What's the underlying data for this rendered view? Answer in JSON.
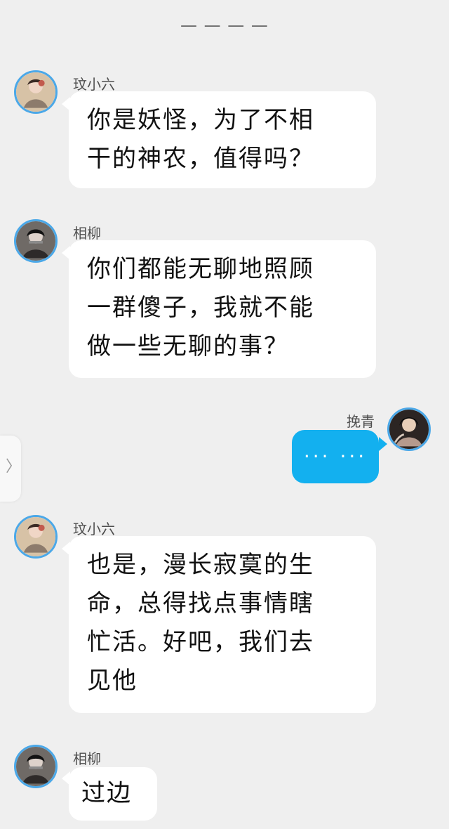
{
  "chat": {
    "top_indicator": "— — — —",
    "messages": [
      {
        "id": 1,
        "sender": "玟小六",
        "side": "left",
        "text": "你是妖怪，为了不相\n干的神农，值得吗？",
        "avatar": "woman-avatar-icon"
      },
      {
        "id": 2,
        "sender": "相柳",
        "side": "left",
        "text": "你们都能无聊地照顾\n一群傻子，我就不能\n做一些无聊的事？",
        "avatar": "man-avatar-icon"
      },
      {
        "id": 3,
        "sender": "挽青",
        "side": "right",
        "text": "··· ···",
        "avatar": "girl-avatar-icon"
      },
      {
        "id": 4,
        "sender": "玟小六",
        "side": "left",
        "text": "也是，漫长寂寞的生\n命，总得找点事情瞎\n忙活。好吧，我们去\n见他",
        "avatar": "woman-avatar-icon"
      },
      {
        "id": 5,
        "sender": "相柳",
        "side": "left",
        "text": "过边",
        "avatar": "man-avatar-icon"
      }
    ]
  },
  "ui": {
    "side_handle_icon": "chevron-right-icon",
    "accent": "#13b0ef",
    "avatar_ring": "#4ba8e8",
    "background": "#efefef"
  }
}
